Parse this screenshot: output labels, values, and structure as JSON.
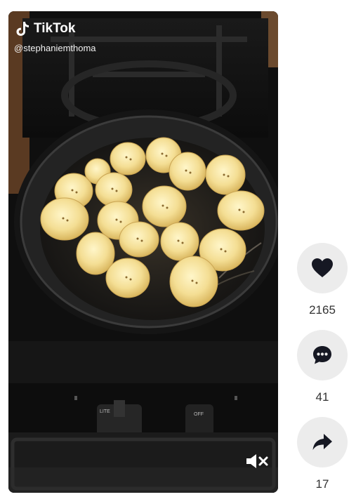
{
  "brand": {
    "name": "TikTok",
    "logo_icon": "tiktok-note-icon"
  },
  "author": {
    "handle": "@stephaniemthoma"
  },
  "video": {
    "description_hidden": true,
    "muted": true,
    "mute_icon": "speaker-muted-icon"
  },
  "actions": [
    {
      "id": "like",
      "icon": "heart-icon",
      "count": "2165"
    },
    {
      "id": "comment",
      "icon": "comment-icon",
      "count": "41"
    },
    {
      "id": "share",
      "icon": "share-arrow-icon",
      "count": "17"
    }
  ],
  "stove_knob_labels": [
    "LITE",
    "OFF"
  ],
  "colors": {
    "action_bg": "#ececec",
    "icon": "#161823",
    "text": "#333333"
  }
}
